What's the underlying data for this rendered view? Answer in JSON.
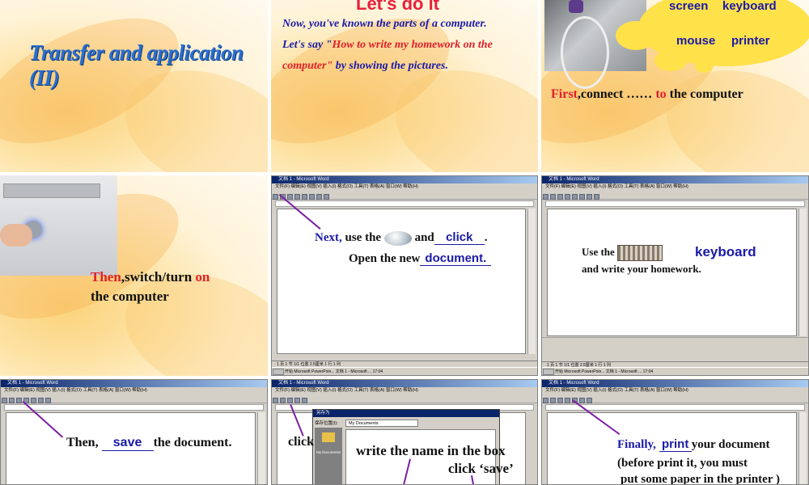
{
  "slide1": {
    "title": "Transfer and application (II)"
  },
  "slide2": {
    "heading": "Let's do it",
    "line1": "Now, you've known the parts of a computer.",
    "line2_prefix": "Let's say \"",
    "line2_red": "How to write my homework on the",
    "line3_red": "computer\"",
    "line3_suffix": " by showing the pictures."
  },
  "slide3": {
    "cloud_words": [
      "screen",
      "keyboard",
      "mouse",
      "printer"
    ],
    "first": "First",
    "connect_text": ",connect …… ",
    "to": "to",
    "end_text": " the computer"
  },
  "slide4": {
    "then": "Then",
    "switch_text": ",switch/turn ",
    "on": "on",
    "line2": "the computer"
  },
  "word": {
    "title": "文档 1 - Microsoft Word",
    "menu": "文件(F)  编辑(E)  视图(V)  插入(I)  格式(O)  工具(T)  表格(A)  窗口(W)  帮助(H)",
    "status": "1 页   1 节   1/1   位置 2.5厘米   1 行  1 列",
    "taskbar": "开始   Microsoft PowerPoin...   文档 1 - Microsoft ...   17:04"
  },
  "slide5": {
    "next": "Next,",
    "use_the": " use the",
    "and": "and",
    "click": "click",
    "period": ".",
    "open_new": "Open the new",
    "document": "document."
  },
  "slide6": {
    "use_the": "Use the",
    "keyboard": "keyboard",
    "line2": "and write your homework."
  },
  "slide7": {
    "then": "Then, ",
    "save": "save",
    "rest": "the document."
  },
  "slide8": {
    "click": "click",
    "dialog_title": "另存为",
    "save_in": "保存位置(I):",
    "folder": "My Documents",
    "side_label": "My Documents",
    "write": "write the name in the box",
    "click_save": "click ‘save’"
  },
  "slide9": {
    "finally": "Finally, ",
    "print": "print",
    "rest": "your document",
    "line2": "(before print it, you must",
    "line3": "put some paper in the printer )"
  },
  "colors": {
    "title_blue": "#2a6fd1",
    "accent_red": "#e0202a",
    "text_blue": "#1a1aa8",
    "pointer_purple": "#7b1fa2",
    "cloud_yellow": "#ffe14a"
  }
}
